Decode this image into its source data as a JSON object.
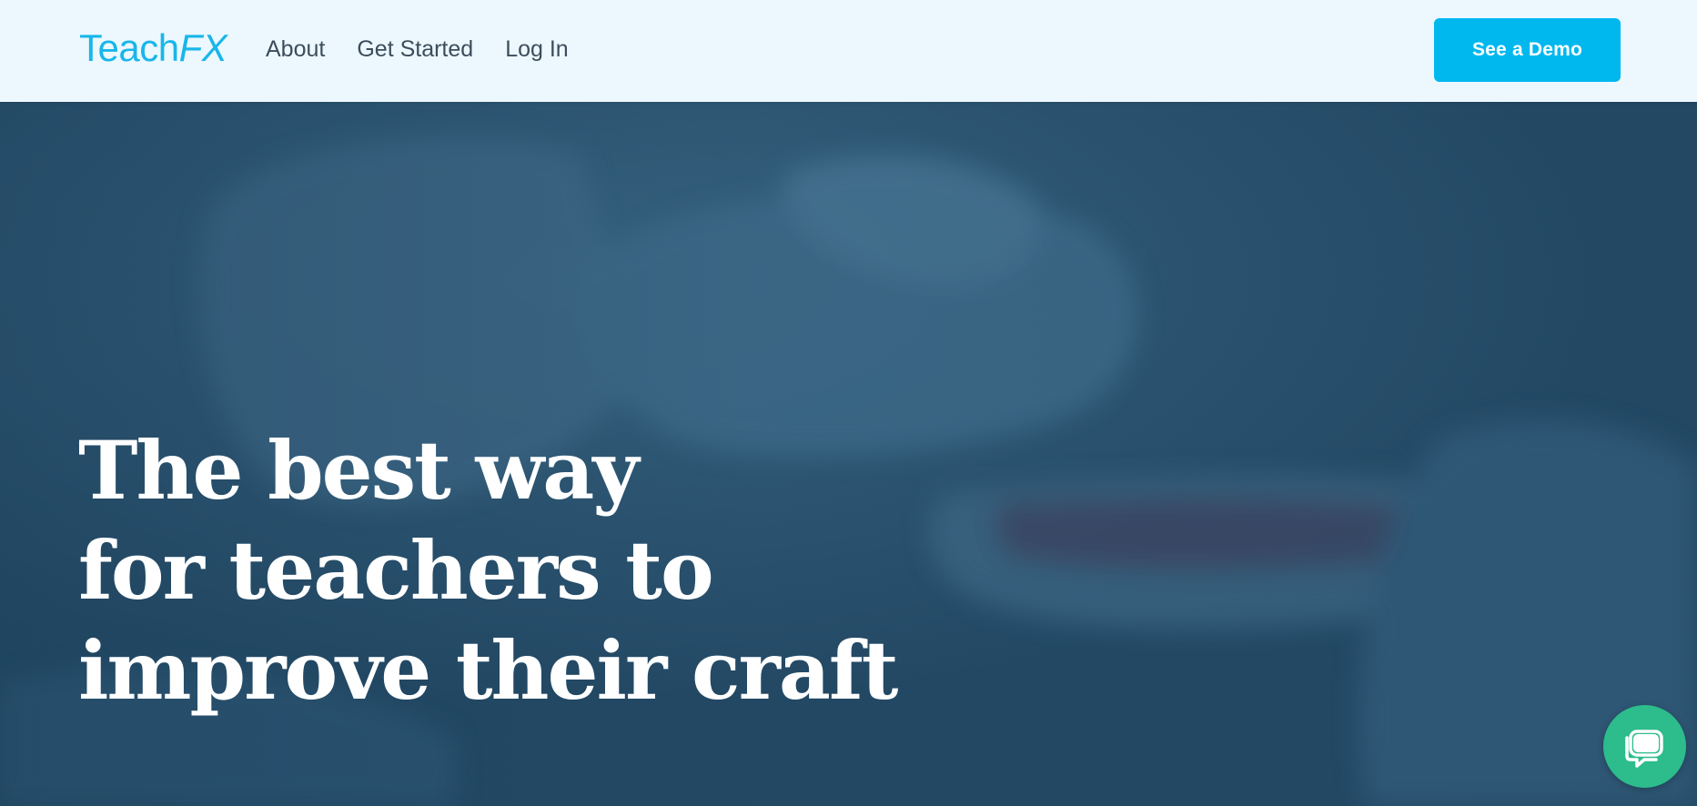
{
  "header": {
    "logo": {
      "teach": "Teach",
      "fx": "FX"
    },
    "nav": [
      {
        "label": "About"
      },
      {
        "label": "Get Started"
      },
      {
        "label": "Log In"
      }
    ],
    "cta_label": "See a Demo"
  },
  "hero": {
    "headline_lines": [
      "The best way",
      "for teachers to",
      "improve their craft"
    ]
  },
  "chat": {
    "icon": "chat-bubble-icon"
  },
  "colors": {
    "header_bg": "#ecf8fe",
    "brand": "#19b6ea",
    "cta": "#00b8ee",
    "hero_tint": "#244a66",
    "chat": "#2dbc8c"
  }
}
